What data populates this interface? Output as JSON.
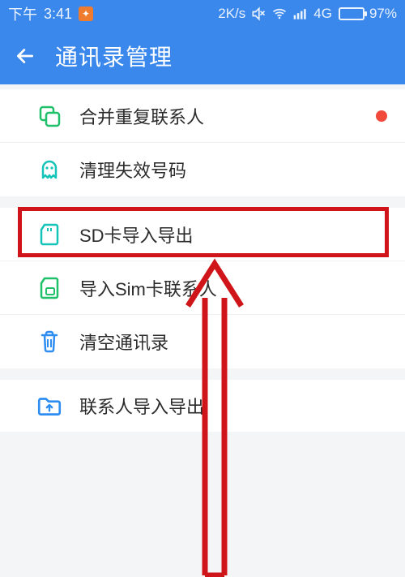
{
  "status": {
    "time_prefix": "下午",
    "time": "3:41",
    "net_speed": "2K/s",
    "network_label": "4G",
    "battery_pct": "97%"
  },
  "header": {
    "title": "通讯录管理"
  },
  "rows": {
    "merge": {
      "label": "合并重复联系人"
    },
    "clean_invalid": {
      "label": "清理失效号码"
    },
    "sd_io": {
      "label": "SD卡导入导出"
    },
    "import_sim": {
      "label": "导入Sim卡联系人"
    },
    "clear_all": {
      "label": "清空通讯录"
    },
    "contacts_io": {
      "label": "联系人导入导出"
    }
  },
  "colors": {
    "primary": "#3b88ec",
    "accent_green": "#1fc06a",
    "accent_teal": "#14c4b8",
    "accent_blue": "#2e8df0",
    "danger": "#f24a3a",
    "annotation": "#cf151a"
  }
}
